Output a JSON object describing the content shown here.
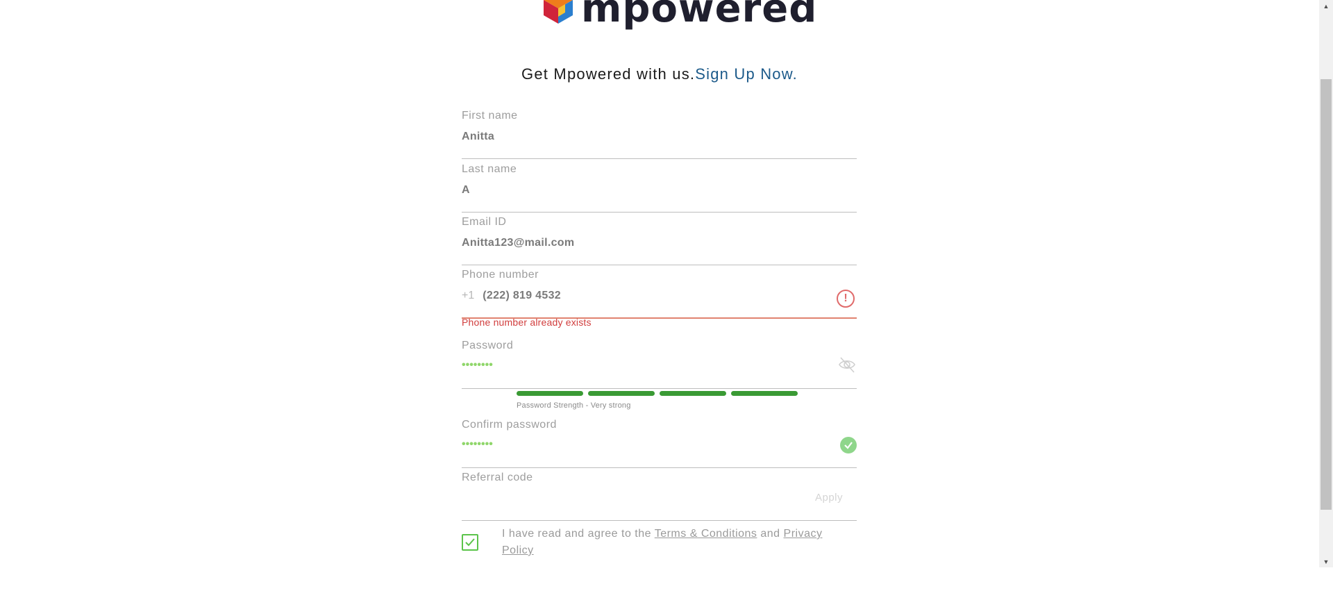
{
  "brand": {
    "name": "mpowered"
  },
  "tagline": {
    "prefix": "Get Mpowered with us.",
    "link": "Sign Up Now."
  },
  "fields": {
    "first_name": {
      "label": "First name",
      "value": "Anitta"
    },
    "last_name": {
      "label": "Last name",
      "value": "A"
    },
    "email": {
      "label": "Email ID",
      "value": "Anitta123@mail.com"
    },
    "phone": {
      "label": "Phone number",
      "prefix": "+1",
      "value": "(222) 819 4532",
      "error": "Phone number already exists"
    },
    "password": {
      "label": "Password",
      "value": "••••••••"
    },
    "confirm_password": {
      "label": "Confirm password",
      "value": "••••••••"
    },
    "referral": {
      "label": "Referral code",
      "value": "",
      "apply_label": "Apply"
    }
  },
  "password_strength": {
    "label": "Password Strength - Very strong",
    "level": 4,
    "max": 4
  },
  "agreement": {
    "checked": true,
    "prefix": "I have read and agree to the ",
    "terms": "Terms & Conditions",
    "and": " and ",
    "privacy": "Privacy Policy"
  },
  "colors": {
    "link": "#1c5a8a",
    "error": "#d13d3d",
    "strength": "#3a9a34",
    "success": "#8fd68b"
  }
}
